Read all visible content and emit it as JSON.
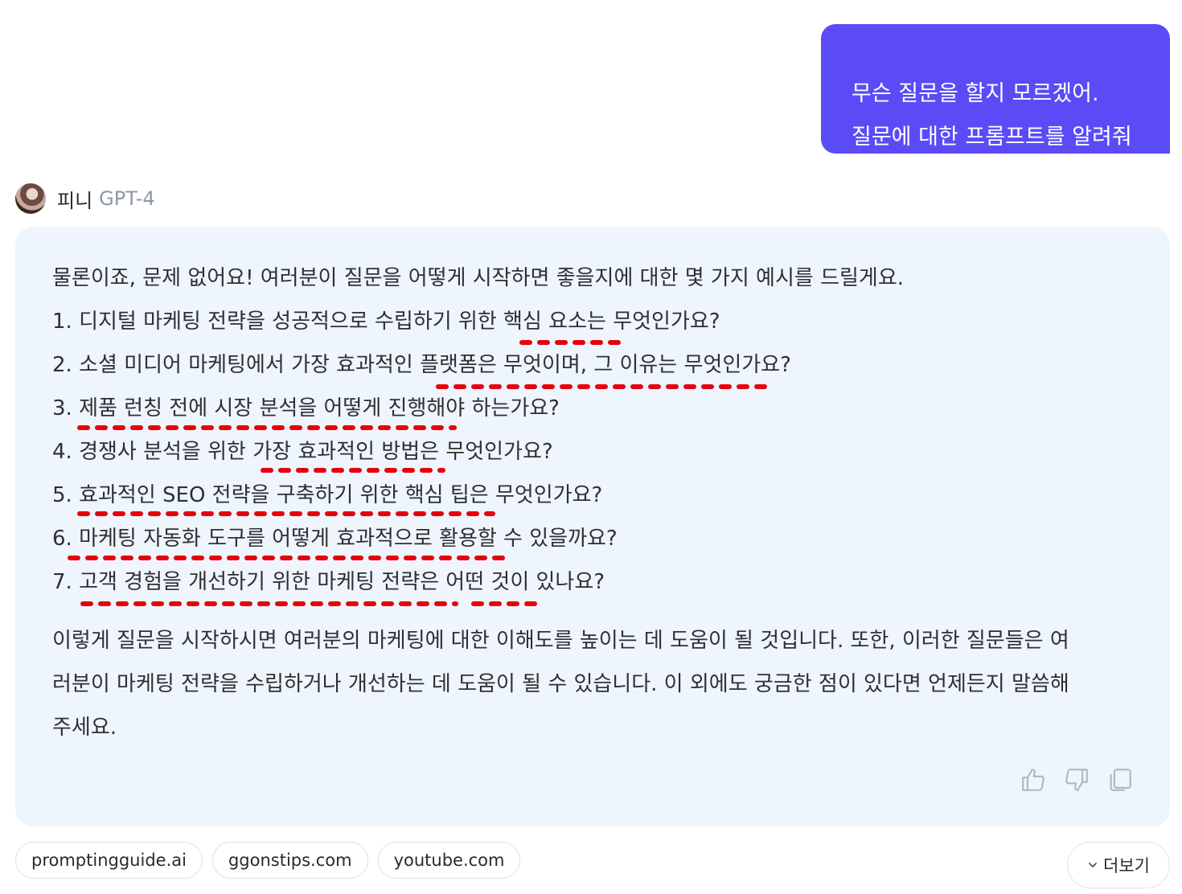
{
  "user_message": {
    "lines": [
      "무슨 질문을 할지 모르겠어.",
      "질문에 대한 프롬프트를 알려줘"
    ],
    "bubble_color": "#5b4bf6"
  },
  "assistant": {
    "name": "피니",
    "model": "GPT-4",
    "avatar_icon": "user-avatar"
  },
  "answer": {
    "intro": "물론이죠, 문제 없어요! 여러분이 질문을 어떻게 시작하면 좋을지에 대한 몇 가지 예시를 드릴게요.",
    "questions": [
      "1. 디지털 마케팅 전략을 성공적으로 수립하기 위한 핵심 요소는 무엇인가요?",
      "2. 소셜 미디어 마케팅에서 가장 효과적인 플랫폼은 무엇이며, 그 이유는 무엇인가요?",
      "3. 제품 런칭 전에 시장 분석을 어떻게 진행해야 하는가요?",
      "4. 경쟁사 분석을 위한 가장 효과적인 방법은 무엇인가요?",
      "5. 효과적인 SEO 전략을 구축하기 위한 핵심 팁은 무엇인가요?",
      "6. 마케팅 자동화 도구를 어떻게 효과적으로 활용할 수 있을까요?",
      "7. 고객 경험을 개선하기 위한 마케팅 전략은 어떤 것이 있나요?"
    ],
    "outro_lines": [
      "이렇게 질문을 시작하시면 여러분의 마케팅에 대한 이해도를 높이는 데 도움이 될 것입니다. 또한, 이러한 질문들은 여",
      "러분이 마케팅 전략을 수립하거나 개선하는 데 도움이 될 수 있습니다. 이 외에도 궁금한 점이 있다면 언제든지 말씀해",
      "주세요."
    ],
    "card_color": "#eef5fd",
    "annotation_color": "#e8000b"
  },
  "actions": {
    "like_icon": "thumbs-up-icon",
    "dislike_icon": "thumbs-down-icon",
    "copy_icon": "copy-icon"
  },
  "sources": [
    "promptingguide.ai",
    "ggonstips.com",
    "youtube.com"
  ],
  "more": {
    "label": "더보기",
    "icon": "chevron-down-icon"
  }
}
